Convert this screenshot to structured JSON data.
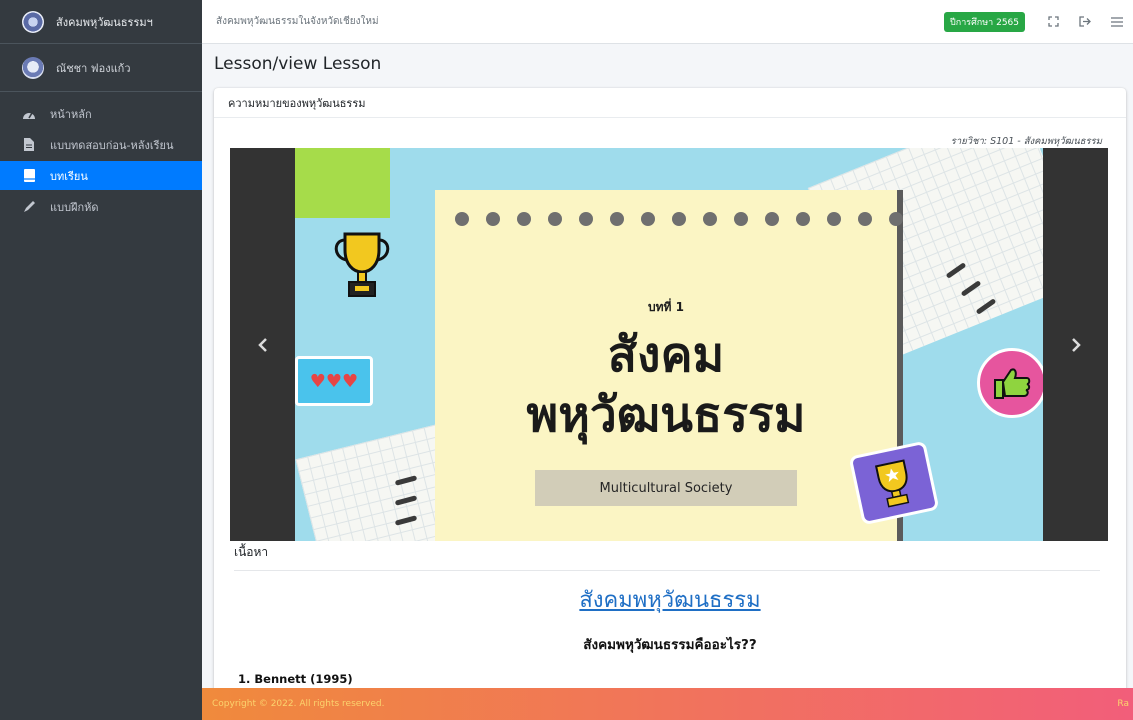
{
  "sidebar": {
    "brand": "สังคมพหุวัฒนธรรมฯ",
    "user_name": "ณัชชา ฟองแก้ว",
    "items": [
      {
        "label": "หน้าหลัก",
        "icon": "dashboard-icon"
      },
      {
        "label": "แบบทดสอบก่อน-หลังเรียน",
        "icon": "file-icon"
      },
      {
        "label": "บทเรียน",
        "icon": "book-icon",
        "active": true
      },
      {
        "label": "แบบฝึกหัด",
        "icon": "pen-icon"
      }
    ],
    "active_color": "#007bff"
  },
  "topbar": {
    "title": "สังคมพหุวัฒนธรรมในจังหวัดเชียงใหม่",
    "badge": "ปีการศึกษา 2565",
    "badge_color": "#28a745",
    "icons": [
      "fullscreen-icon",
      "logout-icon",
      "menu-icon"
    ]
  },
  "page": {
    "heading": "Lesson/view Lesson"
  },
  "card": {
    "header": "ความหมายของพหุวัฒนธรรม",
    "subject": "รายวิชา: S101 - สังคมพหุวัฒนธรรม"
  },
  "slide": {
    "kicker": "บทที่ 1",
    "title_line1": "สังคม",
    "title_line2": "พหุวัฒนธรรม",
    "subtitle": "Multicultural Society"
  },
  "content": {
    "section_label": "เนื้อหา",
    "title": "สังคมพหุวัฒนธรรม",
    "question": "สังคมพหุวัฒนธรรมคืออะไร??",
    "ref1": "1. Bennett (1995)"
  },
  "footer": {
    "copyright": "Copyright © 2022. All rights reserved.",
    "right": "Ra"
  }
}
